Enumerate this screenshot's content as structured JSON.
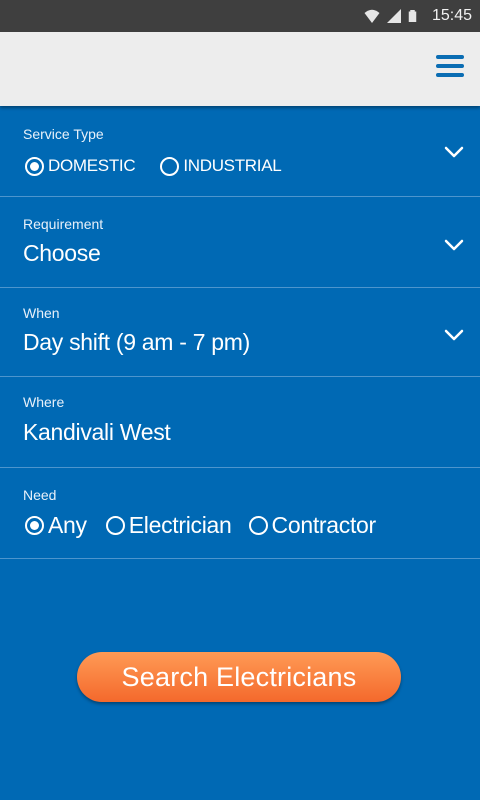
{
  "status_bar": {
    "time": "15:45",
    "icons": [
      "wifi-icon",
      "signal-icon",
      "battery-icon"
    ]
  },
  "app_bar": {
    "menu_icon": "hamburger-menu-icon"
  },
  "form": {
    "service_type": {
      "label": "Service Type",
      "options": [
        {
          "label": "DOMESTIC",
          "selected": true
        },
        {
          "label": "INDUSTRIAL",
          "selected": false
        }
      ]
    },
    "requirement": {
      "label": "Requirement",
      "value": "Choose"
    },
    "when": {
      "label": "When",
      "value": "Day shift (9 am - 7 pm)"
    },
    "where": {
      "label": "Where",
      "value": "Kandivali West"
    },
    "need": {
      "label": "Need",
      "options": [
        {
          "label": "Any",
          "selected": true
        },
        {
          "label": "Electrician",
          "selected": false
        },
        {
          "label": "Contractor",
          "selected": false
        }
      ]
    }
  },
  "search_button": {
    "label": "Search Electricians"
  },
  "colors": {
    "primary_blue": "#0069b4",
    "app_bar": "#ededed",
    "accent_orange": "#f4692c",
    "status_bar": "#3f3f3f"
  }
}
